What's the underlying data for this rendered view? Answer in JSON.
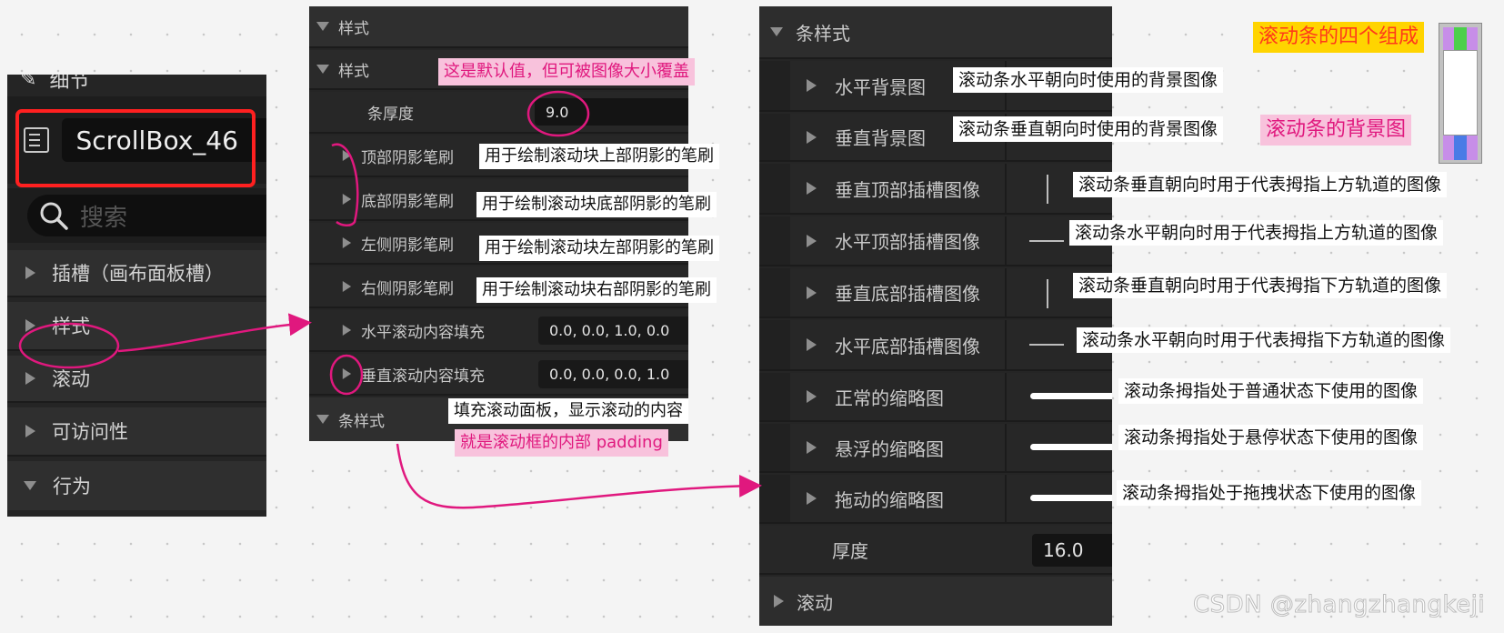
{
  "details_panel": {
    "header_title": "细节",
    "widget_name": "ScrollBox_46",
    "search_placeholder": "搜索",
    "sections": [
      {
        "label": "插槽（画布面板槽）"
      },
      {
        "label": "样式"
      },
      {
        "label": "滚动"
      },
      {
        "label": "可访问性"
      },
      {
        "label": "行为"
      }
    ]
  },
  "style_panel": {
    "header_label": "样式",
    "sub_header_label": "样式",
    "bar_thickness_label": "条厚度",
    "bar_thickness_value": "9.0",
    "rows": [
      {
        "label": "顶部阴影笔刷",
        "note": "用于绘制滚动块上部阴影的笔刷"
      },
      {
        "label": "底部阴影笔刷",
        "note": "用于绘制滚动块底部阴影的笔刷"
      },
      {
        "label": "左侧阴影笔刷",
        "note": "用于绘制滚动块左部阴影的笔刷"
      },
      {
        "label": "右侧阴影笔刷",
        "note": "用于绘制滚动块右部阴影的笔刷"
      }
    ],
    "h_padding_label": "水平滚动内容填充",
    "h_padding_value": "0.0, 0.0, 1.0, 0.0",
    "v_padding_label": "垂直滚动内容填充",
    "v_padding_value": "0.0, 0.0, 0.0, 1.0",
    "bar_style_label": "条样式"
  },
  "bar_style_panel": {
    "header_label": "条样式",
    "rows": [
      {
        "label": "水平背景图",
        "note": "滚动条水平朝向时使用的背景图像"
      },
      {
        "label": "垂直背景图",
        "note": "滚动条垂直朝向时使用的背景图像"
      },
      {
        "label": "垂直顶部插槽图像",
        "note": "滚动条垂直朝向时用于代表拇指上方轨道的图像"
      },
      {
        "label": "水平顶部插槽图像",
        "note": "滚动条水平朝向时用于代表拇指上方轨道的图像"
      },
      {
        "label": "垂直底部插槽图像",
        "note": "滚动条垂直朝向时用于代表拇指下方轨道的图像"
      },
      {
        "label": "水平底部插槽图像",
        "note": "滚动条水平朝向时用于代表拇指下方轨道的图像"
      },
      {
        "label": "正常的缩略图",
        "note": "滚动条拇指处于普通状态下使用的图像"
      },
      {
        "label": "悬浮的缩略图",
        "note": "滚动条拇指处于悬停状态下使用的图像"
      },
      {
        "label": "拖动的缩略图",
        "note": "滚动条拇指处于拖拽状态下使用的图像"
      }
    ],
    "thickness_label": "厚度",
    "thickness_value": "16.0",
    "scroll_label": "滚动"
  },
  "annotations": {
    "default_value_note": "这是默认值，但可被图像大小覆盖",
    "padding_note_1": "填充滚动面板，显示滚动的内容",
    "padding_note_2": "就是滚动框的内部 padding",
    "scrollbar_parts": "滚动条的四个组成",
    "scrollbar_bg": "滚动条的背景图"
  },
  "watermark": "CSDN @zhangzhangkeji",
  "colors": {
    "annotation_pink": "#e0187e",
    "highlight_red": "#ff2020",
    "orange_label_bg": "#ffd400",
    "orange_label_text": "#ff3a1a"
  }
}
